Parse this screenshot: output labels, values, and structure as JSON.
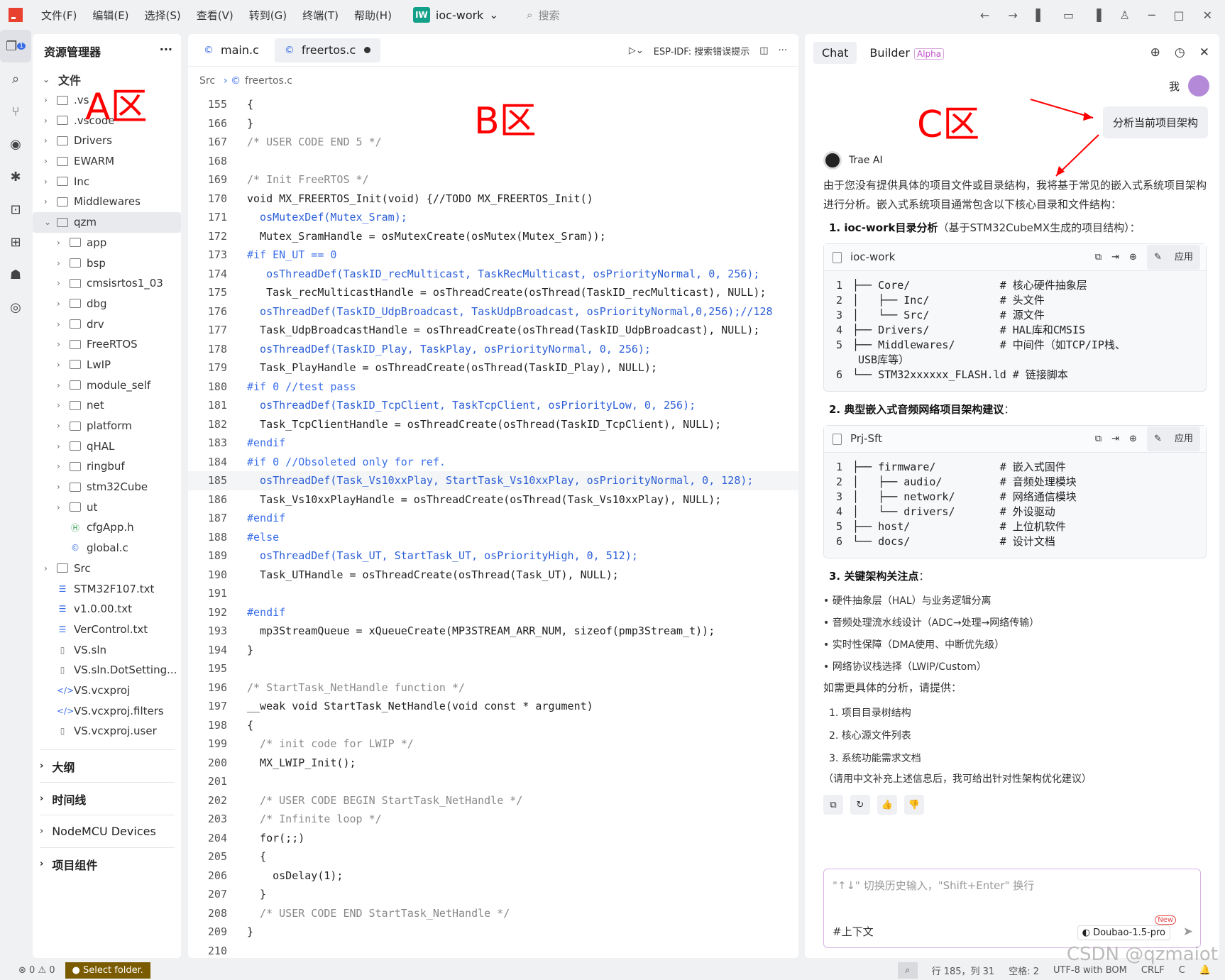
{
  "menu": [
    "文件(F)",
    "编辑(E)",
    "选择(S)",
    "查看(V)",
    "转到(G)",
    "终端(T)",
    "帮助(H)"
  ],
  "project": {
    "badge": "IW",
    "name": "ioc-work"
  },
  "search": {
    "placeholder": "搜索"
  },
  "activity_badge": "1",
  "explorer": {
    "title": "资源管理器",
    "root": "文件",
    "items": [
      {
        "label": ".vs",
        "type": "folder",
        "depth": 1
      },
      {
        "label": ".vscode",
        "type": "folder",
        "depth": 1
      },
      {
        "label": "Drivers",
        "type": "folder",
        "depth": 1
      },
      {
        "label": "EWARM",
        "type": "folder",
        "depth": 1
      },
      {
        "label": "Inc",
        "type": "folder",
        "depth": 1
      },
      {
        "label": "Middlewares",
        "type": "folder",
        "depth": 1
      },
      {
        "label": "qzm",
        "type": "folder-open",
        "depth": 1,
        "selected": true
      },
      {
        "label": "app",
        "type": "folder",
        "depth": 2
      },
      {
        "label": "bsp",
        "type": "folder",
        "depth": 2
      },
      {
        "label": "cmsisrtos1_03",
        "type": "folder",
        "depth": 2
      },
      {
        "label": "dbg",
        "type": "folder",
        "depth": 2
      },
      {
        "label": "drv",
        "type": "folder",
        "depth": 2
      },
      {
        "label": "FreeRTOS",
        "type": "folder",
        "depth": 2
      },
      {
        "label": "LwIP",
        "type": "folder",
        "depth": 2
      },
      {
        "label": "module_self",
        "type": "folder",
        "depth": 2
      },
      {
        "label": "net",
        "type": "folder",
        "depth": 2
      },
      {
        "label": "platform",
        "type": "folder",
        "depth": 2
      },
      {
        "label": "qHAL",
        "type": "folder",
        "depth": 2
      },
      {
        "label": "ringbuf",
        "type": "folder",
        "depth": 2
      },
      {
        "label": "stm32Cube",
        "type": "folder",
        "depth": 2
      },
      {
        "label": "ut",
        "type": "folder",
        "depth": 2
      },
      {
        "label": "cfgApp.h",
        "type": "h",
        "depth": 2
      },
      {
        "label": "global.c",
        "type": "c",
        "depth": 2
      },
      {
        "label": "Src",
        "type": "folder",
        "depth": 1
      },
      {
        "label": "STM32F107.txt",
        "type": "txt",
        "depth": 1
      },
      {
        "label": "v1.0.00.txt",
        "type": "txt",
        "depth": 1
      },
      {
        "label": "VerControl.txt",
        "type": "txt",
        "depth": 1
      },
      {
        "label": "VS.sln",
        "type": "file",
        "depth": 1
      },
      {
        "label": "VS.sln.DotSetting...",
        "type": "file",
        "depth": 1
      },
      {
        "label": "VS.vcxproj",
        "type": "xml",
        "depth": 1
      },
      {
        "label": "VS.vcxproj.filters",
        "type": "xml",
        "depth": 1
      },
      {
        "label": "VS.vcxproj.user",
        "type": "file",
        "depth": 1
      }
    ],
    "sections": [
      "大纲",
      "时间线",
      "NodeMCU Devices",
      "项目组件"
    ]
  },
  "editor": {
    "tabs": [
      {
        "label": "main.c",
        "active": false
      },
      {
        "label": "freertos.c",
        "active": true,
        "modified": true
      }
    ],
    "toolbar": {
      "espidf": "ESP-IDF: 搜索错误提示"
    },
    "breadcrumb": [
      "Src",
      "freertos.c"
    ],
    "lines": [
      {
        "n": "155",
        "t": "{"
      },
      {
        "n": "166",
        "t": "}"
      },
      {
        "n": "167",
        "t": "/* USER CODE END 5 */"
      },
      {
        "n": "168",
        "t": ""
      },
      {
        "n": "169",
        "t": "/* Init FreeRTOS */"
      },
      {
        "n": "170",
        "t": "void MX_FREERTOS_Init(void) {//TODO MX_FREERTOS_Init()"
      },
      {
        "n": "171",
        "t": "  osMutexDef(Mutex_Sram);"
      },
      {
        "n": "172",
        "t": "  Mutex_SramHandle = osMutexCreate(osMutex(Mutex_Sram));"
      },
      {
        "n": "173",
        "t": "#if EN_UT == 0"
      },
      {
        "n": "174",
        "t": "   osThreadDef(TaskID_recMulticast, TaskRecMulticast, osPriorityNormal, 0, 256);"
      },
      {
        "n": "175",
        "t": "   Task_recMulticastHandle = osThreadCreate(osThread(TaskID_recMulticast), NULL);"
      },
      {
        "n": "176",
        "t": "  osThreadDef(TaskID_UdpBroadcast, TaskUdpBroadcast, osPriorityNormal,0,256);//128"
      },
      {
        "n": "177",
        "t": "  Task_UdpBroadcastHandle = osThreadCreate(osThread(TaskID_UdpBroadcast), NULL);"
      },
      {
        "n": "178",
        "t": "  osThreadDef(TaskID_Play, TaskPlay, osPriorityNormal, 0, 256);"
      },
      {
        "n": "179",
        "t": "  Task_PlayHandle = osThreadCreate(osThread(TaskID_Play), NULL);"
      },
      {
        "n": "180",
        "t": "#if 0 //test pass"
      },
      {
        "n": "181",
        "t": "  osThreadDef(TaskID_TcpClient, TaskTcpClient, osPriorityLow, 0, 256);"
      },
      {
        "n": "182",
        "t": "  Task_TcpClientHandle = osThreadCreate(osThread(TaskID_TcpClient), NULL);"
      },
      {
        "n": "183",
        "t": "#endif"
      },
      {
        "n": "184",
        "t": "#if 0 //Obsoleted only for ref."
      },
      {
        "n": "185",
        "t": "  osThreadDef(Task_Vs10xxPlay, StartTask_Vs10xxPlay, osPriorityNormal, 0, 128);"
      },
      {
        "n": "186",
        "t": "  Task_Vs10xxPlayHandle = osThreadCreate(osThread(Task_Vs10xxPlay), NULL);"
      },
      {
        "n": "187",
        "t": "#endif"
      },
      {
        "n": "188",
        "t": "#else"
      },
      {
        "n": "189",
        "t": "  osThreadDef(Task_UT, StartTask_UT, osPriorityHigh, 0, 512);"
      },
      {
        "n": "190",
        "t": "  Task_UTHandle = osThreadCreate(osThread(Task_UT), NULL);"
      },
      {
        "n": "191",
        "t": ""
      },
      {
        "n": "192",
        "t": "#endif"
      },
      {
        "n": "193",
        "t": "  mp3StreamQueue = xQueueCreate(MP3STREAM_ARR_NUM, sizeof(pmp3Stream_t));"
      },
      {
        "n": "194",
        "t": "}"
      },
      {
        "n": "195",
        "t": ""
      },
      {
        "n": "196",
        "t": "/* StartTask_NetHandle function */"
      },
      {
        "n": "197",
        "t": "__weak void StartTask_NetHandle(void const * argument)"
      },
      {
        "n": "198",
        "t": "{"
      },
      {
        "n": "199",
        "t": "  /* init code for LWIP */"
      },
      {
        "n": "200",
        "t": "  MX_LWIP_Init();"
      },
      {
        "n": "201",
        "t": ""
      },
      {
        "n": "202",
        "t": "  /* USER CODE BEGIN StartTask_NetHandle */"
      },
      {
        "n": "203",
        "t": "  /* Infinite loop */"
      },
      {
        "n": "204",
        "t": "  for(;;)"
      },
      {
        "n": "205",
        "t": "  {"
      },
      {
        "n": "206",
        "t": "    osDelay(1);"
      },
      {
        "n": "207",
        "t": "  }"
      },
      {
        "n": "208",
        "t": "  /* USER CODE END StartTask_NetHandle */"
      },
      {
        "n": "209",
        "t": "}"
      },
      {
        "n": "210",
        "t": ""
      }
    ]
  },
  "chat": {
    "tabs": [
      "Chat",
      "Builder"
    ],
    "alpha": "Alpha",
    "user_label": "我",
    "user_message": "分析当前项目架构",
    "ai_name": "Trae AI",
    "intro": "由于您没有提供具体的项目文件或目录结构，我将基于常见的嵌入式系统项目架构进行分析。嵌入式系统项目通常包含以下核心目录和文件结构：",
    "h1_title": "1. ioc-work目录分析",
    "h1_note": "（基于STM32CubeMX生成的项目结构）：",
    "block1": {
      "title": "ioc-work",
      "apply": "应用",
      "rows": [
        {
          "n": "1",
          "t": "├── Core/              # 核心硬件抽象层"
        },
        {
          "n": "2",
          "t": "│   ├── Inc/           # 头文件"
        },
        {
          "n": "3",
          "t": "│   └── Src/           # 源文件"
        },
        {
          "n": "4",
          "t": "├── Drivers/           # HAL库和CMSIS"
        },
        {
          "n": "5",
          "t": "├── Middlewares/       # 中间件（如TCP/IP栈、"
        },
        {
          "n": "",
          "t": "USB库等）"
        },
        {
          "n": "6",
          "t": "└── STM32xxxxxx_FLASH.ld # 链接脚本"
        }
      ]
    },
    "h2_title": "2. 典型嵌入式音频网络项目架构建议",
    "block2": {
      "title": "Prj-Sft",
      "apply": "应用",
      "rows": [
        {
          "n": "1",
          "t": "├── firmware/          # 嵌入式固件"
        },
        {
          "n": "2",
          "t": "│   ├── audio/         # 音频处理模块"
        },
        {
          "n": "3",
          "t": "│   ├── network/       # 网络通信模块"
        },
        {
          "n": "4",
          "t": "│   └── drivers/       # 外设驱动"
        },
        {
          "n": "5",
          "t": "├── host/              # 上位机软件"
        },
        {
          "n": "6",
          "t": "└── docs/              # 设计文档"
        }
      ]
    },
    "h3_title": "3. 关键架构关注点",
    "points": [
      "硬件抽象层（HAL）与业务逻辑分离",
      "音频处理流水线设计（ADC→处理→网络传输）",
      "实时性保障（DMA使用、中断优先级）",
      "网络协议栈选择（LWIP/Custom）"
    ],
    "ask": "如需更具体的分析，请提供：",
    "asks": [
      "1. 项目目录树结构",
      "2. 核心源文件列表",
      "3. 系统功能需求文档"
    ],
    "closing": "（请用中文补充上述信息后，我可给出针对性架构优化建议）",
    "input_placeholder": "\"↑↓\" 切换历史输入，\"Shift+Enter\" 换行",
    "context_label": "#上下文",
    "model": "Doubao-1.5-pro",
    "new_badge": "New"
  },
  "annotations": {
    "a": "A区",
    "b": "B区",
    "c": "C区"
  },
  "status": {
    "errors": "0",
    "warnings": "0",
    "select_folder": "Select folder.",
    "position": "行 185，列 31",
    "spaces": "空格: 2",
    "encoding": "UTF-8 with BOM",
    "eol": "CRLF",
    "lang": "C"
  },
  "watermark": "CSDN @qzmaiot"
}
